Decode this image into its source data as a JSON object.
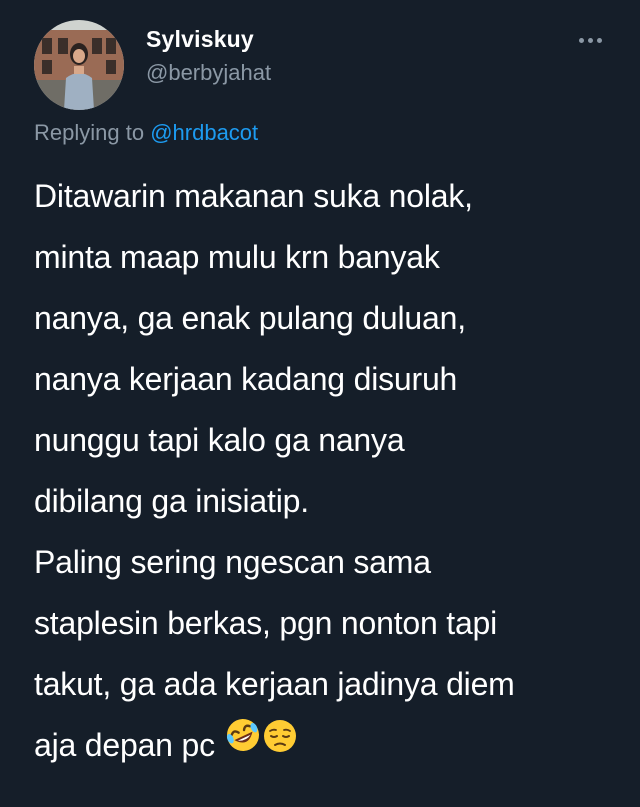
{
  "author": {
    "display_name": "Sylviskuy",
    "handle": "@berbyjahat"
  },
  "reply": {
    "prefix": "Replying to",
    "target": "@hrdbacot"
  },
  "tweet": {
    "lines": [
      "Ditawarin makanan suka nolak,",
      "minta maap mulu krn banyak",
      "nanya, ga enak pulang duluan,",
      "nanya kerjaan kadang disuruh",
      "nunggu tapi kalo ga nanya",
      "dibilang ga inisiatip.",
      "Paling sering ngescan sama",
      "staplesin berkas, pgn nonton tapi",
      "takut, ga ada kerjaan jadinya diem",
      "aja depan pc"
    ],
    "emojis": [
      "rolling-on-floor-laughing-emoji",
      "pensive-face-emoji"
    ]
  },
  "icons": {
    "more": "more-horizontal-icon"
  },
  "colors": {
    "background": "#151e29",
    "text": "#ffffff",
    "secondary_text": "#8b98a5",
    "link": "#1d9bf0"
  }
}
